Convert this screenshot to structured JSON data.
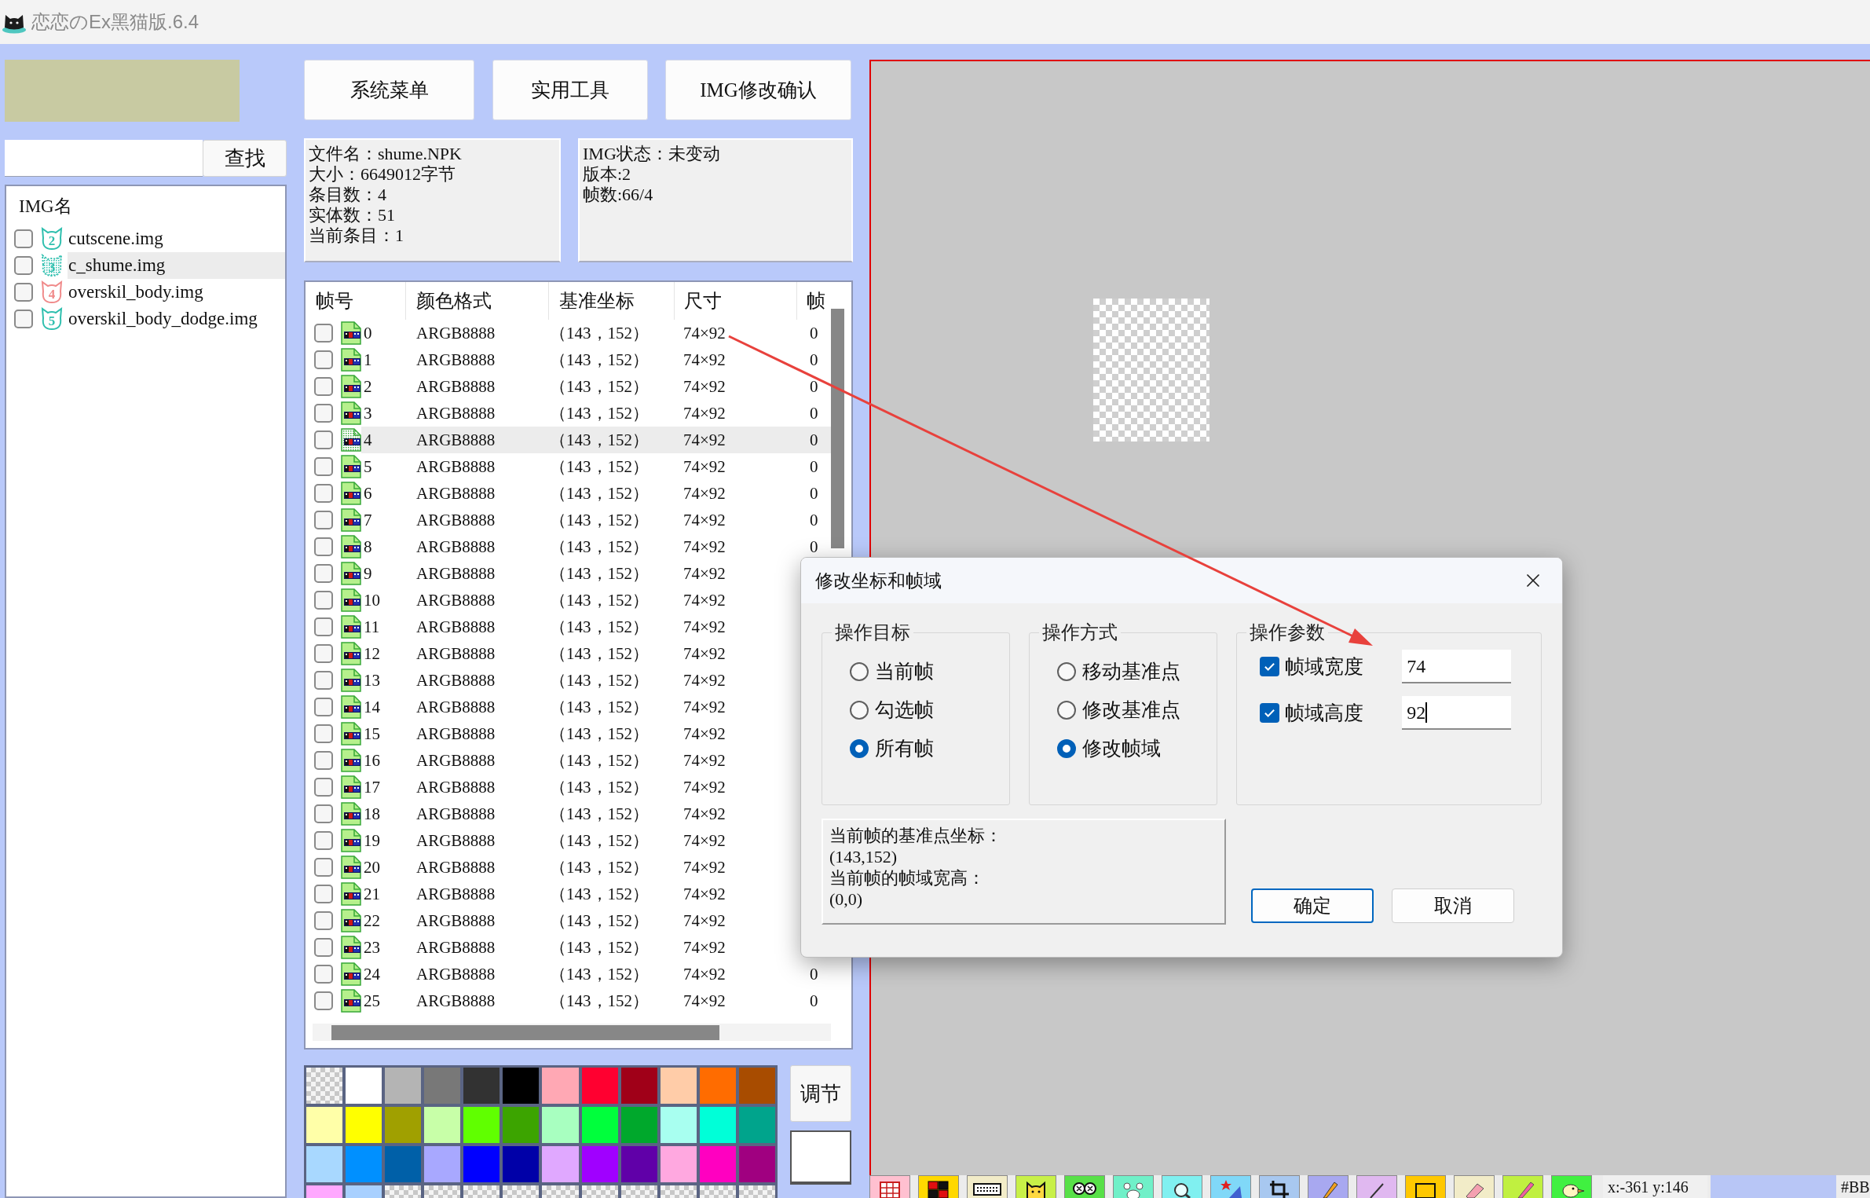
{
  "window": {
    "title": "恋恋のEx黑猫版.6.4"
  },
  "search": {
    "button": "查找"
  },
  "img_list": {
    "header": "IMG名",
    "items": [
      {
        "badge": "2",
        "color": "#2ebfae",
        "name": "cutscene.img",
        "checked": false,
        "selected": false
      },
      {
        "badge": "3",
        "color": "#2ebfae",
        "name": "c_shume.img",
        "checked": false,
        "selected": true
      },
      {
        "badge": "4",
        "color": "#f08a8a",
        "name": "overskil_body.img",
        "checked": false,
        "selected": false
      },
      {
        "badge": "5",
        "color": "#2ebfae",
        "name": "overskil_body_dodge.img",
        "checked": false,
        "selected": false
      }
    ]
  },
  "toolbar": {
    "buttons": [
      "系统菜单",
      "实用工具",
      "IMG修改确认"
    ]
  },
  "file_info": {
    "lines": [
      "文件名：shume.NPK",
      "大小：6649012字节",
      "条目数：4",
      "实体数：51",
      "当前条目：1"
    ]
  },
  "img_info": {
    "lines": [
      "IMG状态：未变动",
      "版本:2",
      "帧数:66/4"
    ]
  },
  "frame_table": {
    "columns": [
      "帧号",
      "颜色格式",
      "基准坐标",
      "尺寸",
      "帧"
    ],
    "rows": [
      {
        "checked": false,
        "selected": false,
        "index": "0",
        "format": "ARGB8888",
        "origin": "（143，152）",
        "size": "74×92",
        "column_5": "0"
      },
      {
        "checked": false,
        "selected": false,
        "index": "1",
        "format": "ARGB8888",
        "origin": "（143，152）",
        "size": "74×92",
        "column_5": "0"
      },
      {
        "checked": false,
        "selected": false,
        "index": "2",
        "format": "ARGB8888",
        "origin": "（143，152）",
        "size": "74×92",
        "column_5": "0"
      },
      {
        "checked": false,
        "selected": false,
        "index": "3",
        "format": "ARGB8888",
        "origin": "（143，152）",
        "size": "74×92",
        "column_5": "0"
      },
      {
        "checked": false,
        "selected": true,
        "index": "4",
        "format": "ARGB8888",
        "origin": "（143，152）",
        "size": "74×92",
        "column_5": "0"
      },
      {
        "checked": false,
        "selected": false,
        "index": "5",
        "format": "ARGB8888",
        "origin": "（143，152）",
        "size": "74×92",
        "column_5": "0"
      },
      {
        "checked": false,
        "selected": false,
        "index": "6",
        "format": "ARGB8888",
        "origin": "（143，152）",
        "size": "74×92",
        "column_5": "0"
      },
      {
        "checked": false,
        "selected": false,
        "index": "7",
        "format": "ARGB8888",
        "origin": "（143，152）",
        "size": "74×92",
        "column_5": "0"
      },
      {
        "checked": false,
        "selected": false,
        "index": "8",
        "format": "ARGB8888",
        "origin": "（143，152）",
        "size": "74×92",
        "column_5": "0"
      },
      {
        "checked": false,
        "selected": false,
        "index": "9",
        "format": "ARGB8888",
        "origin": "（143，152）",
        "size": "74×92"
      },
      {
        "checked": false,
        "selected": false,
        "index": "10",
        "format": "ARGB8888",
        "origin": "（143，152）",
        "size": "74×92"
      },
      {
        "checked": false,
        "selected": false,
        "index": "11",
        "format": "ARGB8888",
        "origin": "（143，152）",
        "size": "74×92"
      },
      {
        "checked": false,
        "selected": false,
        "index": "12",
        "format": "ARGB8888",
        "origin": "（143，152）",
        "size": "74×92"
      },
      {
        "checked": false,
        "selected": false,
        "index": "13",
        "format": "ARGB8888",
        "origin": "（143，152）",
        "size": "74×92"
      },
      {
        "checked": false,
        "selected": false,
        "index": "14",
        "format": "ARGB8888",
        "origin": "（143，152）",
        "size": "74×92"
      },
      {
        "checked": false,
        "selected": false,
        "index": "15",
        "format": "ARGB8888",
        "origin": "（143，152）",
        "size": "74×92"
      },
      {
        "checked": false,
        "selected": false,
        "index": "16",
        "format": "ARGB8888",
        "origin": "（143，152）",
        "size": "74×92"
      },
      {
        "checked": false,
        "selected": false,
        "index": "17",
        "format": "ARGB8888",
        "origin": "（143，152）",
        "size": "74×92"
      },
      {
        "checked": false,
        "selected": false,
        "index": "18",
        "format": "ARGB8888",
        "origin": "（143，152）",
        "size": "74×92"
      },
      {
        "checked": false,
        "selected": false,
        "index": "19",
        "format": "ARGB8888",
        "origin": "（143，152）",
        "size": "74×92"
      },
      {
        "checked": false,
        "selected": false,
        "index": "20",
        "format": "ARGB8888",
        "origin": "（143，152）",
        "size": "74×92"
      },
      {
        "checked": false,
        "selected": false,
        "index": "21",
        "format": "ARGB8888",
        "origin": "（143，152）",
        "size": "74×92"
      },
      {
        "checked": false,
        "selected": false,
        "index": "22",
        "format": "ARGB8888",
        "origin": "（143，152）",
        "size": "74×92"
      },
      {
        "checked": false,
        "selected": false,
        "index": "23",
        "format": "ARGB8888",
        "origin": "（143，152）",
        "size": "74×92"
      },
      {
        "checked": false,
        "selected": false,
        "index": "24",
        "format": "ARGB8888",
        "origin": "（143，152）",
        "size": "74×92",
        "column_5": "0"
      },
      {
        "checked": false,
        "selected": false,
        "index": "25",
        "format": "ARGB8888",
        "origin": "（143，152）",
        "size": "74×92",
        "column_5": "0"
      }
    ]
  },
  "palette": {
    "swatches": [
      {
        "kind": "transparent"
      },
      {
        "kind": "color",
        "color": "#ffffff"
      },
      {
        "kind": "color",
        "color": "#b4b4b4"
      },
      {
        "kind": "color",
        "color": "#787878"
      },
      {
        "kind": "color",
        "color": "#323232"
      },
      {
        "kind": "color",
        "color": "#000000"
      },
      {
        "kind": "color",
        "color": "#ffa8b4"
      },
      {
        "kind": "color",
        "color": "#ff0030"
      },
      {
        "kind": "color",
        "color": "#a00018"
      },
      {
        "kind": "color",
        "color": "#ffcca8"
      },
      {
        "kind": "color",
        "color": "#ff6c00"
      },
      {
        "kind": "color",
        "color": "#a84c00"
      },
      {
        "kind": "color",
        "color": "#ffffa8"
      },
      {
        "kind": "color",
        "color": "#ffff00"
      },
      {
        "kind": "color",
        "color": "#a0a000"
      },
      {
        "kind": "color",
        "color": "#c8ffa8"
      },
      {
        "kind": "color",
        "color": "#60ff00"
      },
      {
        "kind": "color",
        "color": "#3ca400"
      },
      {
        "kind": "color",
        "color": "#a8ffc0"
      },
      {
        "kind": "color",
        "color": "#00ff3c"
      },
      {
        "kind": "color",
        "color": "#00a82c"
      },
      {
        "kind": "color",
        "color": "#a8fff0"
      },
      {
        "kind": "color",
        "color": "#00ffd8"
      },
      {
        "kind": "color",
        "color": "#00a48c"
      },
      {
        "kind": "color",
        "color": "#a8d8ff"
      },
      {
        "kind": "color",
        "color": "#0090ff"
      },
      {
        "kind": "color",
        "color": "#0060a8"
      },
      {
        "kind": "color",
        "color": "#a8a8ff"
      },
      {
        "kind": "color",
        "color": "#0000ff"
      },
      {
        "kind": "color",
        "color": "#0000a8"
      },
      {
        "kind": "color",
        "color": "#e0a8ff"
      },
      {
        "kind": "color",
        "color": "#a000ff"
      },
      {
        "kind": "color",
        "color": "#6000a8"
      },
      {
        "kind": "color",
        "color": "#ffa8e0"
      },
      {
        "kind": "color",
        "color": "#ff00c0"
      },
      {
        "kind": "color",
        "color": "#a00080"
      },
      {
        "kind": "color",
        "color": "#ffa8ff"
      },
      {
        "kind": "color",
        "color": "#a8d0ff"
      },
      {
        "kind": "transparent"
      },
      {
        "kind": "transparent"
      },
      {
        "kind": "transparent"
      },
      {
        "kind": "transparent"
      },
      {
        "kind": "transparent"
      },
      {
        "kind": "transparent"
      },
      {
        "kind": "transparent"
      },
      {
        "kind": "transparent"
      },
      {
        "kind": "transparent"
      },
      {
        "kind": "transparent"
      }
    ],
    "adjust_button": "调节"
  },
  "status_bar": {
    "coords": "x:-361 y:146",
    "color_code": "#BB"
  },
  "dialog": {
    "title": "修改坐标和帧域",
    "groups": [
      {
        "kind": "radio",
        "title": "操作目标",
        "options": [
          {
            "label": "当前帧",
            "selected": false
          },
          {
            "label": "勾选帧",
            "selected": false
          },
          {
            "label": "所有帧",
            "selected": true
          }
        ]
      },
      {
        "kind": "radio",
        "title": "操作方式",
        "options": [
          {
            "label": "移动基准点",
            "selected": false
          },
          {
            "label": "修改基准点",
            "selected": false
          },
          {
            "label": "修改帧域",
            "selected": true
          }
        ]
      },
      {
        "kind": "check",
        "title": "操作参数",
        "options": [
          {
            "label": "帧域宽度",
            "checked": true,
            "value": "74",
            "focused": false
          },
          {
            "label": "帧域高度",
            "checked": true,
            "value": "92",
            "focused": true
          }
        ]
      }
    ],
    "info": [
      "当前帧的基准点坐标：",
      "(143,152)",
      "当前帧的帧域宽高：",
      "(0,0)"
    ],
    "buttons": [
      {
        "label": "确定",
        "default": true
      },
      {
        "label": "取消",
        "default": false
      }
    ]
  }
}
